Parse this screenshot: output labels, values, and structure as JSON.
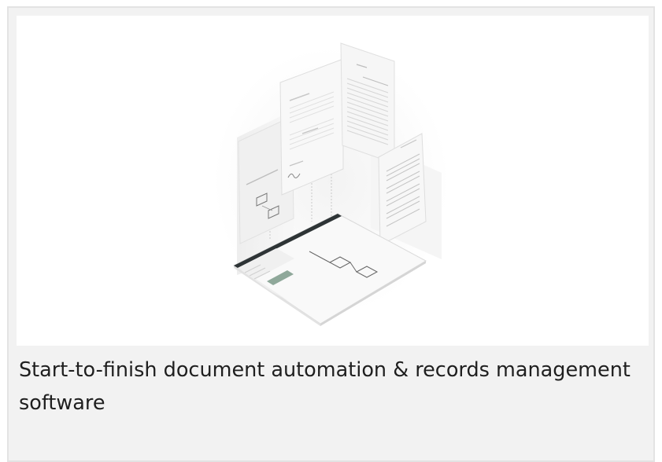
{
  "card": {
    "caption": "Start-to-finish document automation & records management software",
    "illustration_icon": "isometric-document-automation-illustration"
  },
  "colors": {
    "card_background": "#f2f2f2",
    "card_border": "#e3e3e3",
    "caption_text": "#1f1f1f",
    "app_header": "#2e3436",
    "accent": "#8fa89a"
  }
}
